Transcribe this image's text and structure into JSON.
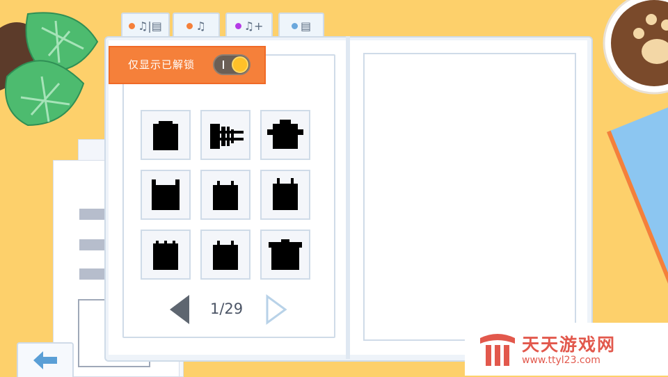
{
  "colors": {
    "background": "#fdd06b",
    "accent": "#f5803a",
    "leaf": "#4dbb6f",
    "watermark": "#e2584c"
  },
  "tabs": [
    {
      "dot": "#f5803a",
      "icon": "bell-book-icon",
      "text": "♫|▤"
    },
    {
      "dot": "#f5803a",
      "icon": "bell-icon",
      "text": "♫"
    },
    {
      "dot": "#b43be6",
      "icon": "bell-plus-icon",
      "text": "♫+"
    },
    {
      "dot": "#6aa7dc",
      "icon": "book-icon",
      "text": "▤"
    }
  ],
  "filter": {
    "label": "仅显示已解锁",
    "toggle_on": true
  },
  "grid": {
    "items": [
      {
        "icon": "locked-silhouette-icon"
      },
      {
        "icon": "locked-silhouette-icon"
      },
      {
        "icon": "locked-silhouette-icon"
      },
      {
        "icon": "locked-silhouette-icon"
      },
      {
        "icon": "locked-silhouette-icon"
      },
      {
        "icon": "locked-silhouette-icon"
      },
      {
        "icon": "locked-silhouette-icon"
      },
      {
        "icon": "locked-silhouette-icon"
      },
      {
        "icon": "locked-silhouette-icon"
      }
    ]
  },
  "pager": {
    "current": 1,
    "total": 29,
    "text": "1/29"
  },
  "watermark": {
    "title": "天天游戏网",
    "url": "www.ttyl23.com"
  }
}
